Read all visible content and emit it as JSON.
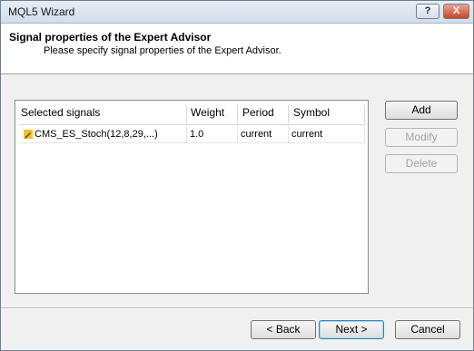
{
  "window": {
    "title": "MQL5 Wizard",
    "help_label": "?",
    "close_label": "X"
  },
  "header": {
    "title": "Signal properties of the Expert Advisor",
    "subtitle": "Please specify signal properties of the Expert Advisor."
  },
  "table": {
    "columns": [
      "Selected signals",
      "Weight",
      "Period",
      "Symbol"
    ],
    "rows": [
      {
        "signal": "CMS_ES_Stoch(12,8,29,...)",
        "weight": "1.0",
        "period": "current",
        "symbol": "current",
        "icon": "pencil-icon"
      }
    ]
  },
  "side_buttons": {
    "add": "Add",
    "modify": "Modify",
    "delete": "Delete"
  },
  "footer_buttons": {
    "back": "< Back",
    "next": "Next >",
    "cancel": "Cancel"
  }
}
